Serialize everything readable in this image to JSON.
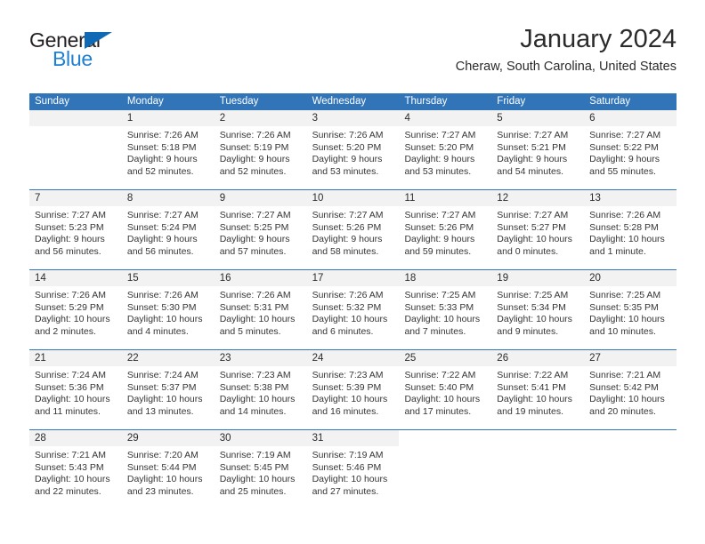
{
  "brand": {
    "name_part1": "General",
    "name_part2": "Blue",
    "triangle_icon": "triangle-icon",
    "accent_color": "#1f7fd0"
  },
  "header": {
    "title": "January 2024",
    "subtitle": "Cheraw, South Carolina, United States"
  },
  "calendar": {
    "header_color": "#3174b8",
    "day_band_color": "#f2f2f2",
    "weekday_headers": [
      "Sunday",
      "Monday",
      "Tuesday",
      "Wednesday",
      "Thursday",
      "Friday",
      "Saturday"
    ],
    "weeks": [
      [
        {
          "day": "",
          "lines": []
        },
        {
          "day": "1",
          "lines": [
            "Sunrise: 7:26 AM",
            "Sunset: 5:18 PM",
            "Daylight: 9 hours",
            "and 52 minutes."
          ]
        },
        {
          "day": "2",
          "lines": [
            "Sunrise: 7:26 AM",
            "Sunset: 5:19 PM",
            "Daylight: 9 hours",
            "and 52 minutes."
          ]
        },
        {
          "day": "3",
          "lines": [
            "Sunrise: 7:26 AM",
            "Sunset: 5:20 PM",
            "Daylight: 9 hours",
            "and 53 minutes."
          ]
        },
        {
          "day": "4",
          "lines": [
            "Sunrise: 7:27 AM",
            "Sunset: 5:20 PM",
            "Daylight: 9 hours",
            "and 53 minutes."
          ]
        },
        {
          "day": "5",
          "lines": [
            "Sunrise: 7:27 AM",
            "Sunset: 5:21 PM",
            "Daylight: 9 hours",
            "and 54 minutes."
          ]
        },
        {
          "day": "6",
          "lines": [
            "Sunrise: 7:27 AM",
            "Sunset: 5:22 PM",
            "Daylight: 9 hours",
            "and 55 minutes."
          ]
        }
      ],
      [
        {
          "day": "7",
          "lines": [
            "Sunrise: 7:27 AM",
            "Sunset: 5:23 PM",
            "Daylight: 9 hours",
            "and 56 minutes."
          ]
        },
        {
          "day": "8",
          "lines": [
            "Sunrise: 7:27 AM",
            "Sunset: 5:24 PM",
            "Daylight: 9 hours",
            "and 56 minutes."
          ]
        },
        {
          "day": "9",
          "lines": [
            "Sunrise: 7:27 AM",
            "Sunset: 5:25 PM",
            "Daylight: 9 hours",
            "and 57 minutes."
          ]
        },
        {
          "day": "10",
          "lines": [
            "Sunrise: 7:27 AM",
            "Sunset: 5:26 PM",
            "Daylight: 9 hours",
            "and 58 minutes."
          ]
        },
        {
          "day": "11",
          "lines": [
            "Sunrise: 7:27 AM",
            "Sunset: 5:26 PM",
            "Daylight: 9 hours",
            "and 59 minutes."
          ]
        },
        {
          "day": "12",
          "lines": [
            "Sunrise: 7:27 AM",
            "Sunset: 5:27 PM",
            "Daylight: 10 hours",
            "and 0 minutes."
          ]
        },
        {
          "day": "13",
          "lines": [
            "Sunrise: 7:26 AM",
            "Sunset: 5:28 PM",
            "Daylight: 10 hours",
            "and 1 minute."
          ]
        }
      ],
      [
        {
          "day": "14",
          "lines": [
            "Sunrise: 7:26 AM",
            "Sunset: 5:29 PM",
            "Daylight: 10 hours",
            "and 2 minutes."
          ]
        },
        {
          "day": "15",
          "lines": [
            "Sunrise: 7:26 AM",
            "Sunset: 5:30 PM",
            "Daylight: 10 hours",
            "and 4 minutes."
          ]
        },
        {
          "day": "16",
          "lines": [
            "Sunrise: 7:26 AM",
            "Sunset: 5:31 PM",
            "Daylight: 10 hours",
            "and 5 minutes."
          ]
        },
        {
          "day": "17",
          "lines": [
            "Sunrise: 7:26 AM",
            "Sunset: 5:32 PM",
            "Daylight: 10 hours",
            "and 6 minutes."
          ]
        },
        {
          "day": "18",
          "lines": [
            "Sunrise: 7:25 AM",
            "Sunset: 5:33 PM",
            "Daylight: 10 hours",
            "and 7 minutes."
          ]
        },
        {
          "day": "19",
          "lines": [
            "Sunrise: 7:25 AM",
            "Sunset: 5:34 PM",
            "Daylight: 10 hours",
            "and 9 minutes."
          ]
        },
        {
          "day": "20",
          "lines": [
            "Sunrise: 7:25 AM",
            "Sunset: 5:35 PM",
            "Daylight: 10 hours",
            "and 10 minutes."
          ]
        }
      ],
      [
        {
          "day": "21",
          "lines": [
            "Sunrise: 7:24 AM",
            "Sunset: 5:36 PM",
            "Daylight: 10 hours",
            "and 11 minutes."
          ]
        },
        {
          "day": "22",
          "lines": [
            "Sunrise: 7:24 AM",
            "Sunset: 5:37 PM",
            "Daylight: 10 hours",
            "and 13 minutes."
          ]
        },
        {
          "day": "23",
          "lines": [
            "Sunrise: 7:23 AM",
            "Sunset: 5:38 PM",
            "Daylight: 10 hours",
            "and 14 minutes."
          ]
        },
        {
          "day": "24",
          "lines": [
            "Sunrise: 7:23 AM",
            "Sunset: 5:39 PM",
            "Daylight: 10 hours",
            "and 16 minutes."
          ]
        },
        {
          "day": "25",
          "lines": [
            "Sunrise: 7:22 AM",
            "Sunset: 5:40 PM",
            "Daylight: 10 hours",
            "and 17 minutes."
          ]
        },
        {
          "day": "26",
          "lines": [
            "Sunrise: 7:22 AM",
            "Sunset: 5:41 PM",
            "Daylight: 10 hours",
            "and 19 minutes."
          ]
        },
        {
          "day": "27",
          "lines": [
            "Sunrise: 7:21 AM",
            "Sunset: 5:42 PM",
            "Daylight: 10 hours",
            "and 20 minutes."
          ]
        }
      ],
      [
        {
          "day": "28",
          "lines": [
            "Sunrise: 7:21 AM",
            "Sunset: 5:43 PM",
            "Daylight: 10 hours",
            "and 22 minutes."
          ]
        },
        {
          "day": "29",
          "lines": [
            "Sunrise: 7:20 AM",
            "Sunset: 5:44 PM",
            "Daylight: 10 hours",
            "and 23 minutes."
          ]
        },
        {
          "day": "30",
          "lines": [
            "Sunrise: 7:19 AM",
            "Sunset: 5:45 PM",
            "Daylight: 10 hours",
            "and 25 minutes."
          ]
        },
        {
          "day": "31",
          "lines": [
            "Sunrise: 7:19 AM",
            "Sunset: 5:46 PM",
            "Daylight: 10 hours",
            "and 27 minutes."
          ]
        },
        {
          "day": "",
          "lines": []
        },
        {
          "day": "",
          "lines": []
        },
        {
          "day": "",
          "lines": []
        }
      ]
    ]
  }
}
